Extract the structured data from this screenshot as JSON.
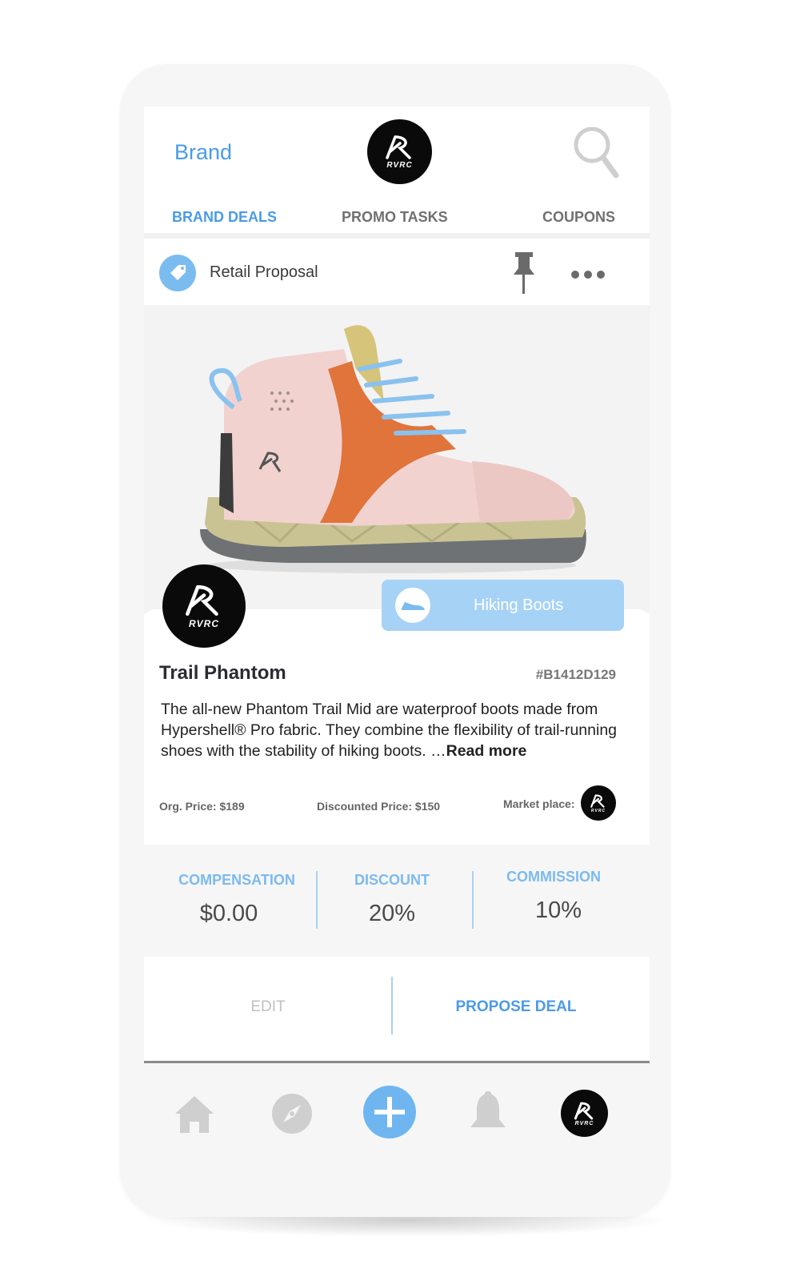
{
  "header": {
    "brand_link": "Brand",
    "logo_text": "RVRC",
    "tabs": [
      {
        "label": "BRAND DEALS",
        "active": true
      },
      {
        "label": "PROMO TASKS",
        "active": false
      },
      {
        "label": "COUPONS",
        "active": false
      }
    ]
  },
  "proposal": {
    "label": "Retail Proposal",
    "icons": [
      "tag-icon",
      "pin-icon",
      "more-icon"
    ]
  },
  "product": {
    "category": "Hiking Boots",
    "name": "Trail Phantom",
    "sku": "#B1412D129",
    "description": "The all-new Phantom Trail Mid are waterproof boots made from Hypershell® Pro fabric. They combine the flexibility of trail-running shoes with the stability of hiking boots. …",
    "read_more": "Read more",
    "original_price": "Org. Price: $189",
    "discounted_price": "Discounted Price: $150",
    "marketplace_label": "Market place:"
  },
  "stats": [
    {
      "title": "COMPENSATION",
      "value": "$0.00"
    },
    {
      "title": "DISCOUNT",
      "value": "20%"
    },
    {
      "title": "COMMISSION",
      "value": "10%"
    }
  ],
  "actions": {
    "edit": "EDIT",
    "propose": "PROPOSE DEAL"
  },
  "bottom_nav": [
    "home-icon",
    "compass-icon",
    "add-icon",
    "bell-icon",
    "profile-avatar"
  ],
  "colors": {
    "accent": "#4b9be8",
    "accent_light": "#a6d2f6",
    "logo_bg": "#0a0a0a"
  }
}
